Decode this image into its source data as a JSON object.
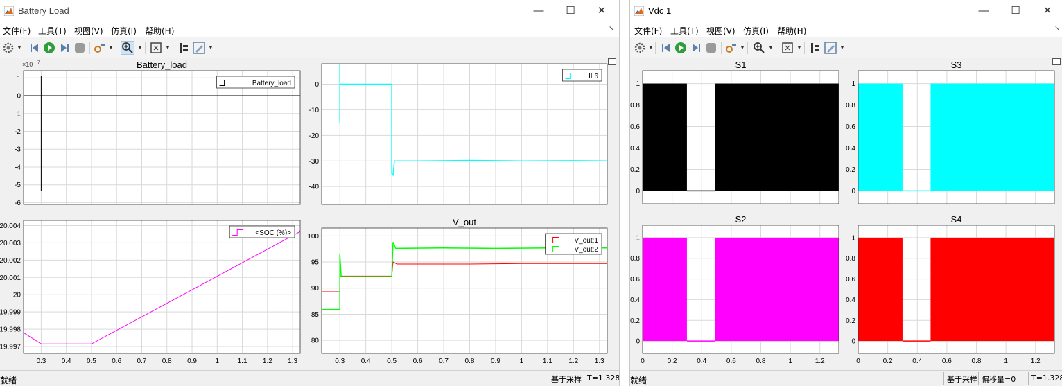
{
  "left_window": {
    "title": "Battery Load",
    "menu": [
      "文件(F)",
      "工具(T)",
      "视图(V)",
      "仿真(I)",
      "帮助(H)"
    ],
    "status": {
      "left": "就绪",
      "mode": "基于采样",
      "time": "T=1.328"
    }
  },
  "right_window": {
    "title": "Vdc 1",
    "menu": [
      "文件(F)",
      "工具(T)",
      "视图(V)",
      "仿真(I)",
      "帮助(H)"
    ],
    "status": {
      "left": "就绪",
      "mode": "基于采样",
      "offset": "偏移量=0",
      "time": "T=1.328"
    }
  },
  "toolbar_icons": [
    "settings-icon",
    "step-back-icon",
    "run-icon",
    "step-forward-icon",
    "stop-icon",
    "highlight-icon",
    "zoom-in-icon",
    "fit-axes-icon",
    "cursor-icon",
    "edit-icon"
  ],
  "window_controls": {
    "minimize": "—",
    "maximize": "☐",
    "close": "✕"
  },
  "colors": {
    "black": "#000000",
    "cyan": "#00ffff",
    "magenta": "#ff00ff",
    "red": "#ff0000",
    "green": "#00ff00",
    "grid": "#d9d9d9"
  },
  "chart_data": [
    {
      "id": "battery-load",
      "type": "line",
      "title": "Battery_load",
      "exponent": "×10",
      "exponent_power": "7",
      "xlim": [
        0.23,
        1.33
      ],
      "ylim": [
        -6.1,
        1.4
      ],
      "x_ticks": [
        0.3,
        0.4,
        0.5,
        0.6,
        0.7,
        0.8,
        0.9,
        1,
        1.1,
        1.2,
        1.3
      ],
      "show_x_labels": false,
      "y_ticks": [
        1,
        0,
        -1,
        -2,
        -3,
        -4,
        -5,
        -6
      ],
      "y_tick_labels": [
        "1",
        "0",
        "-1",
        "-2",
        "-3",
        "-4",
        "-5",
        "-6"
      ],
      "legend": [
        {
          "name": "Battery_load",
          "color": "#000000"
        }
      ],
      "series": [
        {
          "name": "Battery_load",
          "color": "#000000",
          "points": [
            [
              0.23,
              0
            ],
            [
              0.3,
              0
            ],
            [
              0.3,
              1.1
            ],
            [
              0.3,
              -5.35
            ],
            [
              0.3,
              0
            ],
            [
              1.33,
              0
            ]
          ]
        }
      ]
    },
    {
      "id": "il6",
      "type": "line",
      "title": "",
      "xlim": [
        0.23,
        1.33
      ],
      "ylim": [
        -47,
        8
      ],
      "x_ticks": [
        0.3,
        0.4,
        0.5,
        0.6,
        0.7,
        0.8,
        0.9,
        1,
        1.1,
        1.2,
        1.3
      ],
      "show_x_labels": false,
      "y_ticks": [
        0,
        -10,
        -20,
        -30,
        -40
      ],
      "y_tick_labels": [
        "0",
        "-10",
        "-20",
        "-30",
        "-40"
      ],
      "legend": [
        {
          "name": "IL6",
          "color": "#00ffff"
        }
      ],
      "series": [
        {
          "name": "IL6",
          "color": "#00ffff",
          "width": 1.5,
          "points": [
            [
              0.23,
              8
            ],
            [
              0.3,
              8
            ],
            [
              0.3,
              -15
            ],
            [
              0.3,
              0
            ],
            [
              0.5,
              0
            ],
            [
              0.5,
              -35
            ],
            [
              0.505,
              -35.5
            ],
            [
              0.51,
              -30
            ],
            [
              0.6,
              -30
            ],
            [
              0.8,
              -29.8
            ],
            [
              1.0,
              -30
            ],
            [
              1.2,
              -29.9
            ],
            [
              1.33,
              -30
            ]
          ]
        }
      ]
    },
    {
      "id": "soc",
      "type": "line",
      "title": "",
      "xlim": [
        0.23,
        1.33
      ],
      "ylim": [
        19.9966,
        20.0043
      ],
      "x_ticks": [
        0.3,
        0.4,
        0.5,
        0.6,
        0.7,
        0.8,
        0.9,
        1,
        1.1,
        1.2,
        1.3
      ],
      "show_x_labels": true,
      "x_tick_labels": [
        "0.3",
        "0.4",
        "0.5",
        "0.6",
        "0.7",
        "0.8",
        "0.9",
        "1",
        "1.1",
        "1.2",
        "1.3"
      ],
      "y_ticks": [
        20.004,
        20.003,
        20.002,
        20.001,
        20,
        19.999,
        19.998,
        19.997
      ],
      "y_tick_labels": [
        "20.004",
        "20.003",
        "20.002",
        "20.001",
        "20",
        "19.999",
        "19.998",
        "19.997"
      ],
      "legend": [
        {
          "name": "<SOC (%)>",
          "color": "#ff00ff"
        }
      ],
      "series": [
        {
          "name": "<SOC (%)>",
          "color": "#ff00ff",
          "points": [
            [
              0.23,
              19.9978
            ],
            [
              0.3,
              19.99715
            ],
            [
              0.5,
              19.99715
            ],
            [
              1.33,
              20.00365
            ]
          ]
        }
      ]
    },
    {
      "id": "v-out",
      "type": "line",
      "title": "V_out",
      "xlim": [
        0.23,
        1.33
      ],
      "ylim": [
        77.5,
        101.5
      ],
      "x_ticks": [
        0.3,
        0.4,
        0.5,
        0.6,
        0.7,
        0.8,
        0.9,
        1,
        1.1,
        1.2,
        1.3
      ],
      "show_x_labels": true,
      "x_tick_labels": [
        "0.3",
        "0.4",
        "0.5",
        "0.6",
        "0.7",
        "0.8",
        "0.9",
        "1",
        "1.1",
        "1.2",
        "1.3"
      ],
      "y_ticks": [
        100,
        95,
        90,
        85,
        80
      ],
      "y_tick_labels": [
        "100",
        "95",
        "90",
        "85",
        "80"
      ],
      "legend": [
        {
          "name": "V_out:1",
          "color": "#ff0000"
        },
        {
          "name": "V_out:2",
          "color": "#00ff00"
        }
      ],
      "series": [
        {
          "name": "V_out:1",
          "color": "#ff0000",
          "points": [
            [
              0.23,
              89.3
            ],
            [
              0.3,
              89.3
            ],
            [
              0.3,
              85.8
            ],
            [
              0.3,
              92.3
            ],
            [
              0.5,
              92.3
            ],
            [
              0.505,
              95
            ],
            [
              0.52,
              94.6
            ],
            [
              0.8,
              94.6
            ],
            [
              1.0,
              94.7
            ],
            [
              1.33,
              94.7
            ]
          ]
        },
        {
          "name": "V_out:2",
          "color": "#00ff00",
          "width": 1.5,
          "points": [
            [
              0.23,
              85.9
            ],
            [
              0.3,
              85.9
            ],
            [
              0.3,
              96.5
            ],
            [
              0.305,
              92.2
            ],
            [
              0.5,
              92.2
            ],
            [
              0.505,
              98.8
            ],
            [
              0.515,
              97.6
            ],
            [
              0.7,
              97.7
            ],
            [
              0.9,
              97.6
            ],
            [
              1.1,
              97.7
            ],
            [
              1.33,
              97.7
            ]
          ]
        }
      ]
    },
    {
      "id": "s1",
      "type": "area",
      "title": "S1",
      "color": "#000000",
      "xlim": [
        0,
        1.328
      ],
      "ylim": [
        -0.12,
        1.12
      ],
      "x_ticks": [
        0,
        0.2,
        0.4,
        0.6,
        0.8,
        1,
        1.2
      ],
      "x_tick_labels": [
        "0",
        "0.2",
        "0.4",
        "0.6",
        "0.8",
        "1",
        "1.2"
      ],
      "show_x_labels": false,
      "y_ticks": [
        0,
        0.2,
        0.4,
        0.6,
        0.8,
        1
      ],
      "y_tick_labels": [
        "0",
        "0.2",
        "0.4",
        "0.6",
        "0.8",
        "1"
      ],
      "on_intervals": [
        [
          0,
          0.3
        ],
        [
          0.49,
          1.328
        ]
      ],
      "off_level": 0,
      "on_level": 1
    },
    {
      "id": "s3",
      "type": "area",
      "title": "S3",
      "color": "#00ffff",
      "xlim": [
        0,
        1.328
      ],
      "ylim": [
        -0.12,
        1.12
      ],
      "x_ticks": [
        0,
        0.2,
        0.4,
        0.6,
        0.8,
        1,
        1.2
      ],
      "x_tick_labels": [
        "0",
        "0.2",
        "0.4",
        "0.6",
        "0.8",
        "1",
        "1.2"
      ],
      "show_x_labels": false,
      "y_ticks": [
        0,
        0.2,
        0.4,
        0.6,
        0.8,
        1
      ],
      "y_tick_labels": [
        "0",
        "0.2",
        "0.4",
        "0.6",
        "0.8",
        "1"
      ],
      "on_intervals": [
        [
          0,
          0.3
        ],
        [
          0.49,
          1.328
        ]
      ],
      "off_level": 0,
      "on_level": 1
    },
    {
      "id": "s2",
      "type": "area",
      "title": "S2",
      "color": "#ff00ff",
      "xlim": [
        0,
        1.328
      ],
      "ylim": [
        -0.12,
        1.12
      ],
      "x_ticks": [
        0,
        0.2,
        0.4,
        0.6,
        0.8,
        1,
        1.2
      ],
      "x_tick_labels": [
        "0",
        "0.2",
        "0.4",
        "0.6",
        "0.8",
        "1",
        "1.2"
      ],
      "show_x_labels": true,
      "y_ticks": [
        0,
        0.2,
        0.4,
        0.6,
        0.8,
        1
      ],
      "y_tick_labels": [
        "0",
        "0.2",
        "0.4",
        "0.6",
        "0.8",
        "1"
      ],
      "on_intervals": [
        [
          0,
          0.3
        ],
        [
          0.49,
          1.328
        ]
      ],
      "off_level": 0,
      "on_level": 1
    },
    {
      "id": "s4",
      "type": "area",
      "title": "S4",
      "color": "#ff0000",
      "xlim": [
        0,
        1.328
      ],
      "ylim": [
        -0.12,
        1.12
      ],
      "x_ticks": [
        0,
        0.2,
        0.4,
        0.6,
        0.8,
        1,
        1.2
      ],
      "x_tick_labels": [
        "0",
        "0.2",
        "0.4",
        "0.6",
        "0.8",
        "1",
        "1.2"
      ],
      "show_x_labels": true,
      "y_ticks": [
        0,
        0.2,
        0.4,
        0.6,
        0.8,
        1
      ],
      "y_tick_labels": [
        "0",
        "0.2",
        "0.4",
        "0.6",
        "0.8",
        "1"
      ],
      "on_intervals": [
        [
          0,
          0.3
        ],
        [
          0.49,
          1.328
        ]
      ],
      "off_level": 0,
      "on_level": 1
    }
  ]
}
